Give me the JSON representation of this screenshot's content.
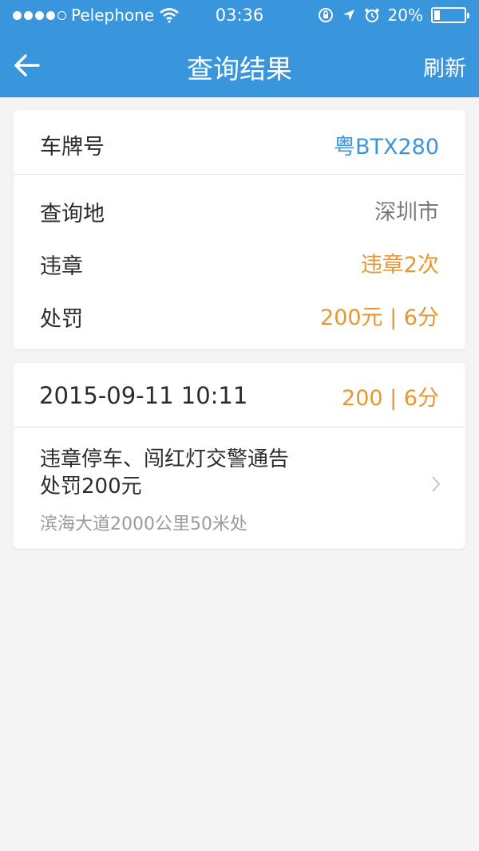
{
  "status_bar": {
    "carrier": "Pelephone",
    "time": "03:36",
    "battery": "20%",
    "battery_level": 0.2
  },
  "nav": {
    "title": "查询结果",
    "refresh_label": "刷新",
    "back_icon": "arrow-left-icon"
  },
  "summary": {
    "plate_label": "车牌号",
    "plate_value": "粤BTX280",
    "location_label": "查询地",
    "location_value": "深圳市",
    "violation_label": "违章",
    "violation_value": "违章2次",
    "penalty_label": "处罚",
    "penalty_value": "200元 | 6分"
  },
  "records": [
    {
      "datetime": "2015-09-11  10:11",
      "penalty": "200 | 6分",
      "desc_line1": "违章停车、闯红灯交警通告",
      "desc_line2": "处罚200元",
      "address": "滨海大道2000公里50米处"
    }
  ],
  "colors": {
    "accent": "#3a96dc",
    "warning": "#e8962f"
  }
}
